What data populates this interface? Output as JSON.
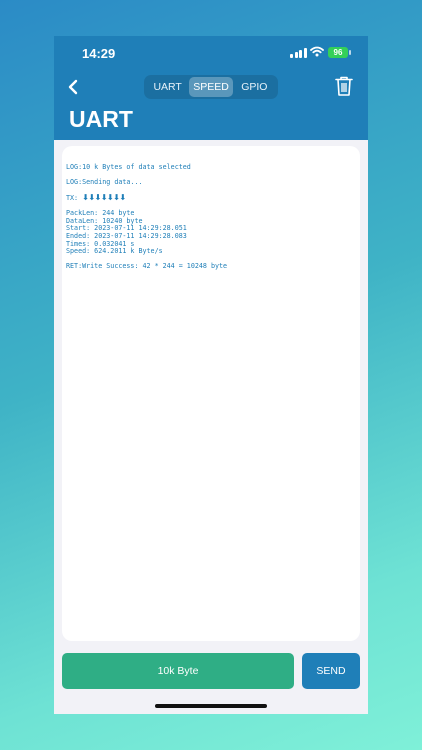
{
  "status_bar": {
    "time": "14:29",
    "battery": "96"
  },
  "nav": {
    "tabs": [
      {
        "label": "UART",
        "active": false
      },
      {
        "label": "SPEED",
        "active": true
      },
      {
        "label": "GPIO",
        "active": false
      }
    ],
    "back_icon": "chevron-left-icon",
    "trash_icon": "trash-icon"
  },
  "page": {
    "title": "UART"
  },
  "log": {
    "selected": "LOG:10 k Bytes of data selected",
    "sending": "LOG:Sending data...",
    "tx_label": "TX: ",
    "tx_arrows": "⬇⬇⬇⬇⬇⬇⬇",
    "pack_len": "PackLen: 244 byte",
    "data_len": "DataLen: 10240 byte",
    "start": "Start: 2023-07-11 14:29:28.051",
    "ended": "Ended: 2023-07-11 14:29:28.083",
    "times": "Times: 0.032041 s",
    "speed": "Speed: 624.2011 k Byte/s",
    "result": "RET:Write Success: 42 * 244 = 10248 byte"
  },
  "actions": {
    "size_label": "10k Byte",
    "send_label": "SEND"
  },
  "colors": {
    "accent": "#1f7fb8",
    "send_green": "#2fae85",
    "battery_green": "#34d058"
  }
}
